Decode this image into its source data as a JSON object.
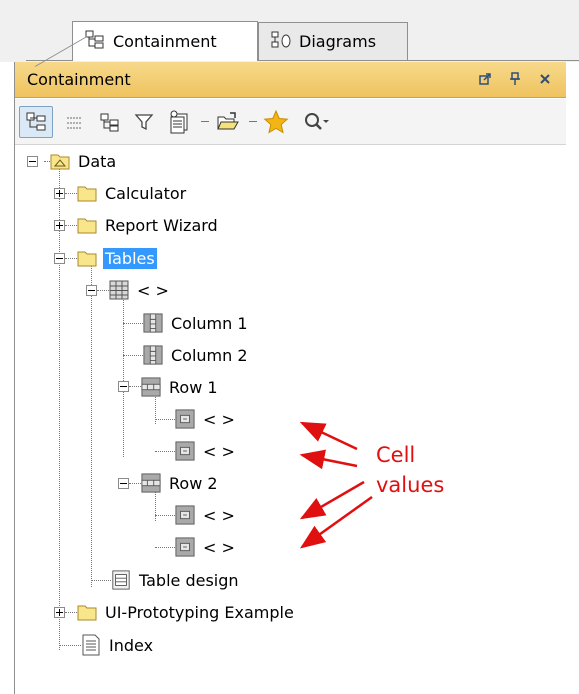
{
  "tabs": [
    {
      "label": "Containment",
      "icon": "containment-tree-icon",
      "active": true
    },
    {
      "label": "Diagrams",
      "icon": "diagrams-icon",
      "active": false
    }
  ],
  "panel": {
    "title": "Containment",
    "header_buttons": [
      "float-window-icon",
      "pin-icon",
      "close-icon"
    ],
    "toolbar_icons": [
      "toggle-tree-view-icon",
      "quick-filter-icon",
      "show-hierarchy-icon",
      "filter-icon",
      "new-element-icon",
      "open-folder-icon",
      "favorite-star-icon",
      "search-icon"
    ]
  },
  "tree": {
    "data": "Data",
    "calculator": "Calculator",
    "report_wizard": "Report Wizard",
    "tables": "Tables",
    "table_unnamed": "< >",
    "column1": "Column 1",
    "column2": "Column 2",
    "row1": "Row 1",
    "row1_cell1": "< >",
    "row1_cell2": "< >",
    "row2": "Row 2",
    "row2_cell1": "< >",
    "row2_cell2": "< >",
    "table_design": "Table design",
    "ui_prototyping": "UI-Prototyping Example",
    "index": "Index"
  },
  "annotation": {
    "text": "Cell\nvalues",
    "color": "#e01010"
  },
  "colors": {
    "header": "#efc35f",
    "selection": "#3399ff",
    "folder": "#f9e68a"
  }
}
